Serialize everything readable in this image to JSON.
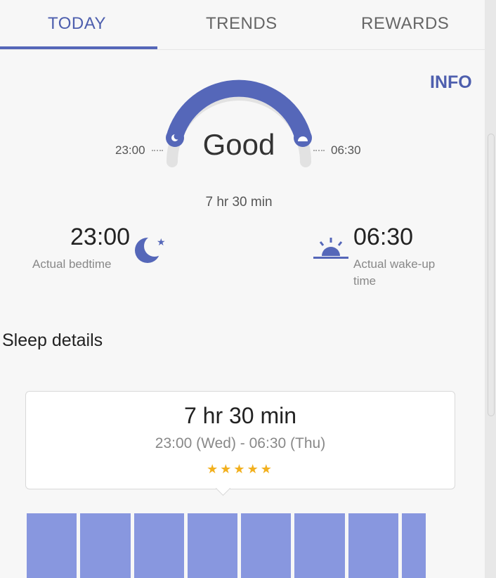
{
  "tabs": [
    {
      "label": "TODAY",
      "active": true
    },
    {
      "label": "TRENDS",
      "active": false
    },
    {
      "label": "REWARDS",
      "active": false
    }
  ],
  "info_label": "INFO",
  "gauge": {
    "rating": "Good",
    "duration": "7 hr 30 min",
    "start_time": "23:00",
    "end_time": "06:30",
    "accent_color": "#5567b9"
  },
  "bedtime": {
    "time": "23:00",
    "label": "Actual bedtime",
    "icon": "moon-star-icon"
  },
  "wakeup": {
    "time": "06:30",
    "label_line1": "Actual wake-up",
    "label_line2": "time",
    "icon": "sunrise-icon"
  },
  "sleep_details": {
    "title": "Sleep details",
    "duration": "7 hr 30 min",
    "range": "23:00 (Wed) - 06:30 (Thu)",
    "stars": "★★★★★",
    "star_count": 5
  },
  "colors": {
    "accent": "#5567b9",
    "bars": "#8897df",
    "stars": "#f2b01e"
  }
}
